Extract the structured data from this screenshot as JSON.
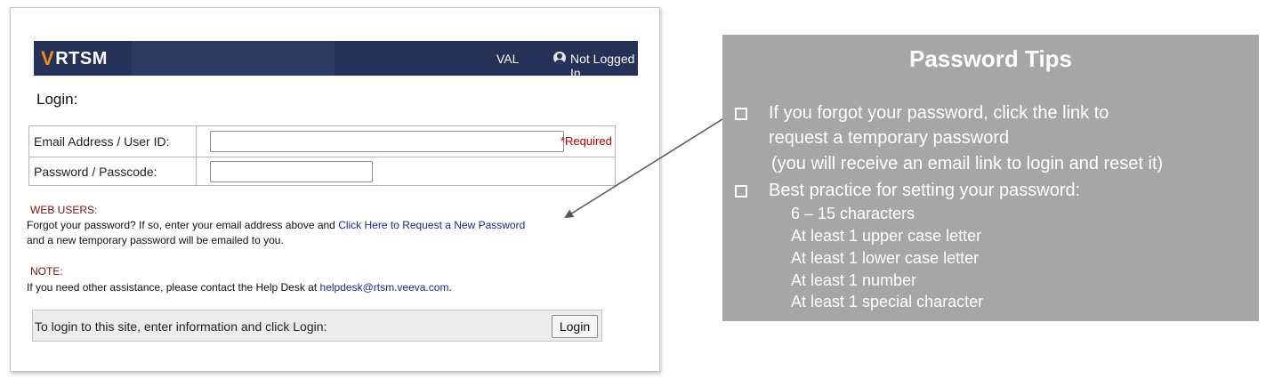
{
  "app": {
    "logo_mark": "V",
    "logo_text": "RTSM",
    "environment": "VAL",
    "login_status": "Not Logged In"
  },
  "login": {
    "heading": "Login:",
    "fields": [
      {
        "label": "Email Address / User ID:",
        "value": "",
        "required_text": "*Required"
      },
      {
        "label": "Password / Passcode:",
        "value": ""
      }
    ],
    "web_users_title": "WEB USERS:",
    "forgot_line1_prefix": "Forgot your password? If so, enter your email address above and ",
    "forgot_link": "Click Here to Request a New Password",
    "forgot_line2": "and a new temporary password will be emailed to you.",
    "note_title": "NOTE:",
    "note_prefix": "If you need other assistance, please contact the Help Desk at ",
    "note_email": "helpdesk@rtsm.veeva.com",
    "note_suffix": ".",
    "footer_text": "To login to this site, enter information and click Login:",
    "login_button": "Login"
  },
  "tips": {
    "title": "Password Tips",
    "tip1_line1": "If you forgot your password, click the link to",
    "tip1_line2": "request a temporary password",
    "tip1_line3": "(you will receive an email link to login and reset it)",
    "tip2": "Best practice for setting your password:",
    "rules": [
      "6 – 15 characters",
      "At least 1 upper case letter",
      "At least 1 lower case letter",
      "At least 1 number",
      "At least 1 special character"
    ]
  },
  "colors": {
    "header_bg": "#253156",
    "logo_accent": "#f08c1c",
    "required": "#c00000",
    "link": "#1a2b8c",
    "tips_bg": "#a6a6a6"
  }
}
